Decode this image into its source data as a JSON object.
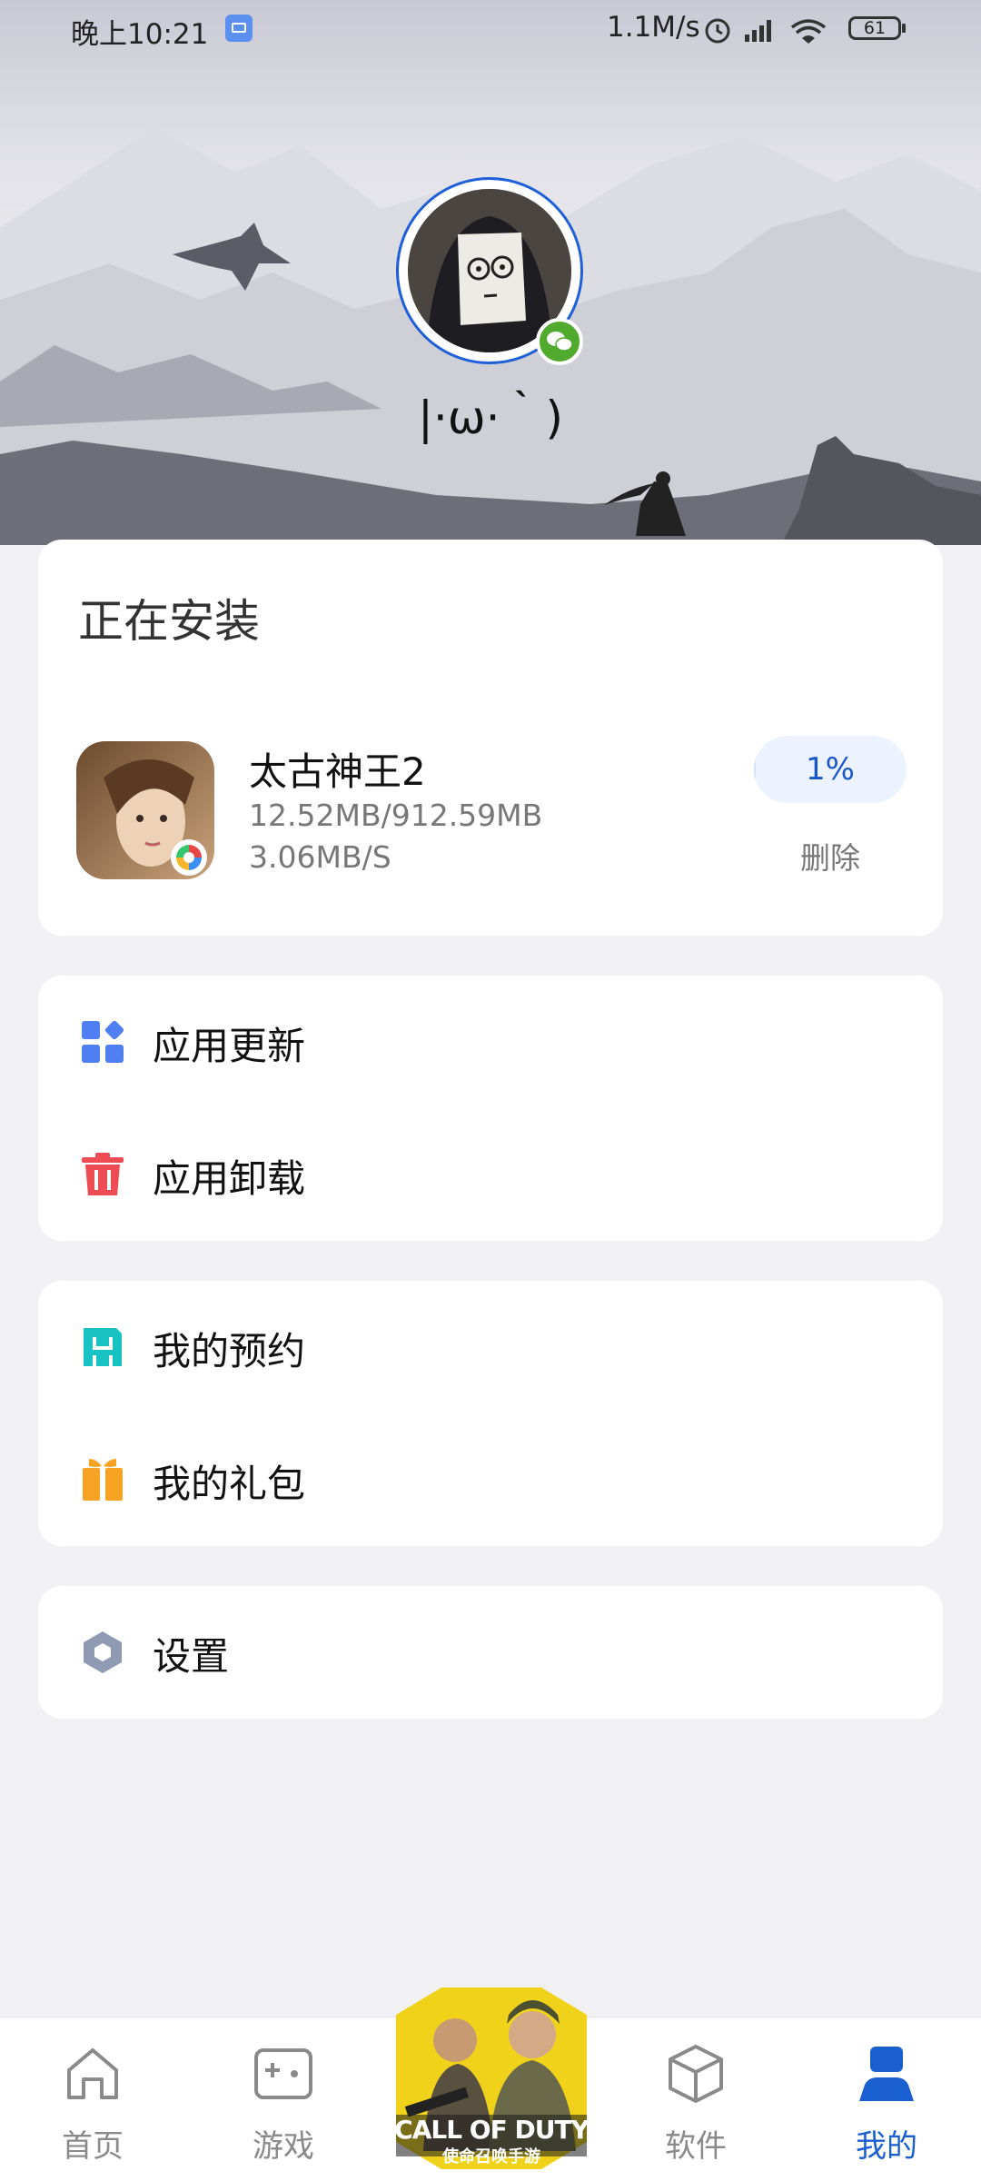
{
  "status_bar": {
    "time": "晚上10:21",
    "net_speed": "1.1M/s",
    "battery": "61",
    "icons": [
      "mail-icon",
      "alarm-icon",
      "hd-signal-icon",
      "wifi-icon",
      "battery-icon"
    ]
  },
  "profile": {
    "nickname": "|·ω·｀)",
    "login_badge": "wechat-icon"
  },
  "installing": {
    "title": "正在安装",
    "app": {
      "name": "太古神王2",
      "size": "12.52MB/912.59MB",
      "speed": "3.06MB/S",
      "progress_label": "1%",
      "progress_fraction": 0.01,
      "delete_label": "删除"
    }
  },
  "menu_groups": [
    {
      "items": [
        {
          "label": "应用更新",
          "icon": "app-update-icon",
          "color": "#4f7ff0"
        },
        {
          "label": "应用卸载",
          "icon": "trash-icon",
          "color": "#ee4b55"
        }
      ]
    },
    {
      "items": [
        {
          "label": "我的预约",
          "icon": "reservation-icon",
          "color": "#19c2c2"
        },
        {
          "label": "我的礼包",
          "icon": "gift-icon",
          "color": "#f6a323"
        }
      ]
    },
    {
      "items": [
        {
          "label": "设置",
          "icon": "settings-hexagon-icon",
          "color": "#8e9bb3"
        }
      ]
    }
  ],
  "tab_bar": {
    "tabs": [
      {
        "label": "首页",
        "icon": "home-icon",
        "active": false
      },
      {
        "label": "游戏",
        "icon": "gamepad-icon",
        "active": false
      },
      {
        "label": "软件",
        "icon": "box-icon",
        "active": false
      },
      {
        "label": "我的",
        "icon": "profile-icon",
        "active": true
      }
    ],
    "promo_banner": {
      "title": "CALL OF DUTY",
      "subtitle": "使命召唤手游"
    }
  },
  "colors": {
    "accent": "#1a5fd0",
    "progress_bg": "#ecf3fe",
    "page_bg": "#f1f1f3"
  }
}
